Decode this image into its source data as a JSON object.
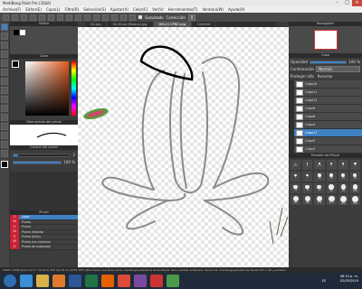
{
  "window": {
    "title": "MediBang Paint Pro (32bit)"
  },
  "menu": [
    "Archivo(F)",
    "Editar(E)",
    "Capa(L)",
    "Filtro(R)",
    "Selección(S)",
    "Ajustar(A)",
    "Color(C)",
    "Ver(V)",
    "Herramientas(T)",
    "Ventana(W)",
    "Ayuda(H)"
  ],
  "toolbar": {
    "smoothing_label": "Suavizado",
    "correction_label": "Corrección",
    "correction_value": "0"
  },
  "tabs": [
    "EG.jpg",
    "Sin título (Bloque).jpg",
    "DELLO CPNE.png",
    "Untitled"
  ],
  "panels": {
    "paleta": "Paleta",
    "color": "Color",
    "vista_previa": "Vista previa del pincel",
    "control": "Control del pincel",
    "control_values": {
      "size": "2",
      "opacity": "100 %"
    },
    "pincel": "Pincel",
    "navegador": "Navegador",
    "capa": "Capa",
    "tamano": "Tamaño del Pincel"
  },
  "brushes": [
    {
      "num": "2",
      "name": "Lápiz",
      "selected": true
    },
    {
      "num": "10",
      "name": "Pluma",
      "selected": false
    },
    {
      "num": "5",
      "name": "Pluma",
      "selected": false
    },
    {
      "num": "15",
      "name": "Pluma redonda",
      "selected": false
    },
    {
      "num": "5",
      "name": "Pluma (tinta)",
      "selected": false
    },
    {
      "num": "40",
      "name": "Pluma con contorno",
      "selected": false
    },
    {
      "num": "5",
      "name": "Pluma de suavizado",
      "selected": false
    }
  ],
  "layer_panel": {
    "opacity_label": "Opacidad",
    "opacity_value": "100 %",
    "blend_label": "Combinación",
    "blend_value": "Normal",
    "protect_label": "Proteger alfa",
    "clip_label": "Recortar",
    "layers": [
      {
        "name": "Capa10",
        "selected": false
      },
      {
        "name": "Capa11",
        "selected": false
      },
      {
        "name": "Capa12",
        "selected": false
      },
      {
        "name": "Capa9",
        "selected": false
      },
      {
        "name": "Capa8",
        "selected": false
      },
      {
        "name": "Capa4",
        "selected": false
      },
      {
        "name": "Capa17",
        "selected": true
      },
      {
        "name": "Capa5",
        "selected": false
      },
      {
        "name": "Capa3",
        "selected": false
      }
    ]
  },
  "brush_sizes": [
    "0.7",
    "1",
    "1.5",
    "2",
    "3",
    "4",
    "5",
    "7",
    "10",
    "12",
    "15",
    "20",
    "25",
    "30",
    "40",
    "50",
    "70",
    "100",
    "150",
    "200",
    "250",
    "300",
    "400",
    "500"
  ],
  "status": {
    "text": "2960 * 2000 pixel (12.8 * 16.9cm) 350 dpi 36 % (3270, 657) Para trazar una línea recta, mantenga pulsada la tecla Mayús. Para cambiar el tamaño del pincel, mantenga pulsada las teclas Ctrl + Alt y arrastre"
  },
  "clock": {
    "time": "08:10 p. m.",
    "date": "02/05/2019"
  },
  "tray": {
    "lang": "ES"
  },
  "colors": {
    "accent": "#3d82c4",
    "taskbar": "#1f2b3a"
  }
}
